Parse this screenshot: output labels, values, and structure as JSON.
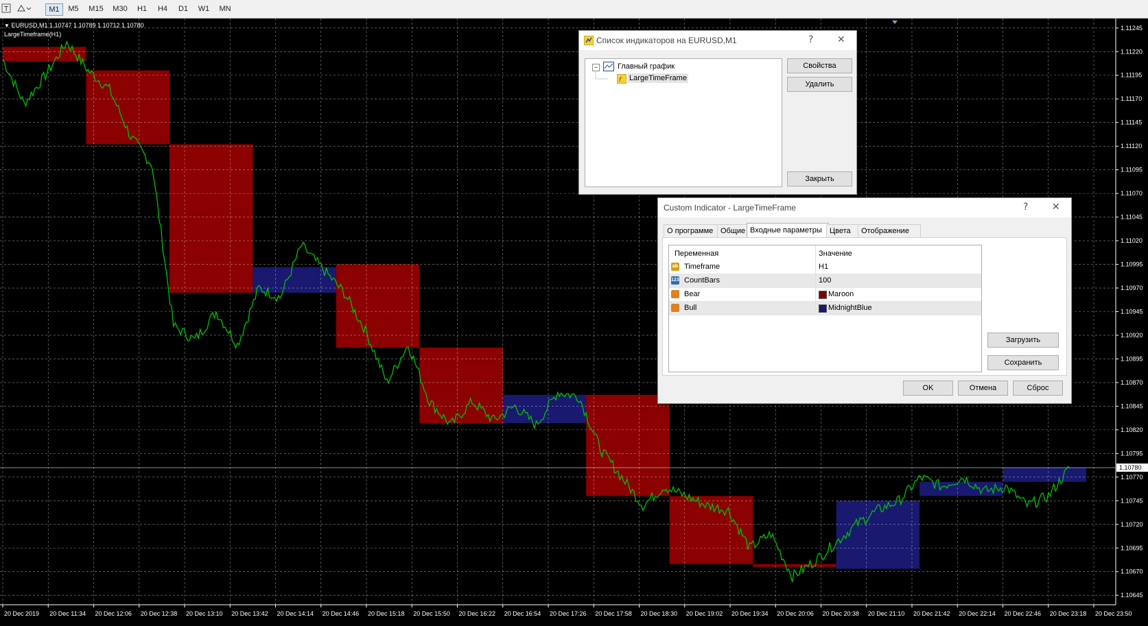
{
  "toolbar": {
    "icons": [
      "text-tool-icon",
      "shapes-tool-icon"
    ],
    "timeframes": [
      "M1",
      "M5",
      "M15",
      "M30",
      "H1",
      "H4",
      "D1",
      "W1",
      "MN"
    ],
    "active_timeframe": "M1"
  },
  "chart": {
    "header_line1": "EURUSD,M1  1.10747 1.10789 1.10712 1.10780",
    "header_line2": "LargeTimeframe(H1)",
    "current_price": "1.10780",
    "price_labels": [
      "1.11245",
      "1.11220",
      "1.11195",
      "1.11170",
      "1.11145",
      "1.11120",
      "1.11095",
      "1.11070",
      "1.11045",
      "1.11020",
      "1.10995",
      "1.10970",
      "1.10945",
      "1.10920",
      "1.10895",
      "1.10870",
      "1.10845",
      "1.10820",
      "1.10795",
      "1.10770",
      "1.10745",
      "1.10720",
      "1.10695",
      "1.10670",
      "1.10645"
    ],
    "time_labels": [
      "20 Dec 2019",
      "20 Dec 11:34",
      "20 Dec 12:06",
      "20 Dec 12:38",
      "20 Dec 13:10",
      "20 Dec 13:42",
      "20 Dec 14:14",
      "20 Dec 14:46",
      "20 Dec 15:18",
      "20 Dec 15:50",
      "20 Dec 16:22",
      "20 Dec 16:54",
      "20 Dec 17:26",
      "20 Dec 17:58",
      "20 Dec 18:30",
      "20 Dec 19:02",
      "20 Dec 19:34",
      "20 Dec 20:06",
      "20 Dec 20:38",
      "20 Dec 21:10",
      "20 Dec 21:42",
      "20 Dec 22:14",
      "20 Dec 22:46",
      "20 Dec 23:18",
      "20 Dec 23:50"
    ],
    "colors": {
      "bear": "#8b0000",
      "bull": "#191970",
      "line": "#00c000",
      "grid": "#ffffff",
      "background": "#000000"
    },
    "boxes": [
      {
        "dir": "bear",
        "open": 1.11225,
        "close": 1.1121,
        "start": 0,
        "end": 1
      },
      {
        "dir": "bear",
        "open": 1.112,
        "close": 1.11122,
        "start": 1,
        "end": 2
      },
      {
        "dir": "bear",
        "open": 1.11122,
        "close": 1.10965,
        "start": 2,
        "end": 3
      },
      {
        "dir": "bull",
        "open": 1.10965,
        "close": 1.10992,
        "start": 3,
        "end": 4
      },
      {
        "dir": "bear",
        "open": 1.10995,
        "close": 1.10907,
        "start": 4,
        "end": 5
      },
      {
        "dir": "bear",
        "open": 1.10907,
        "close": 1.10827,
        "start": 5,
        "end": 6
      },
      {
        "dir": "bull",
        "open": 1.10827,
        "close": 1.10857,
        "start": 6,
        "end": 7
      },
      {
        "dir": "bear",
        "open": 1.10857,
        "close": 1.1075,
        "start": 7,
        "end": 8
      },
      {
        "dir": "bear",
        "open": 1.1075,
        "close": 1.10678,
        "start": 8,
        "end": 9
      },
      {
        "dir": "bear",
        "open": 1.10678,
        "close": 1.10675,
        "start": 9,
        "end": 10
      },
      {
        "dir": "bull",
        "open": 1.10673,
        "close": 1.10745,
        "start": 10,
        "end": 11
      },
      {
        "dir": "bull",
        "open": 1.1075,
        "close": 1.10765,
        "start": 11,
        "end": 12
      },
      {
        "dir": "bull",
        "open": 1.10765,
        "close": 1.1078,
        "start": 12,
        "end": 13
      }
    ],
    "price_path": [
      1.11212,
      1.11165,
      1.11195,
      1.1123,
      1.112,
      1.1118,
      1.1113,
      1.111,
      1.1093,
      1.10915,
      1.10945,
      1.1091,
      1.1097,
      1.1096,
      1.11015,
      1.1099,
      1.10965,
      1.10925,
      1.1087,
      1.1091,
      1.1085,
      1.10825,
      1.1085,
      1.1083,
      1.10845,
      1.10825,
      1.1086,
      1.10855,
      1.108,
      1.1077,
      1.1074,
      1.1076,
      1.1075,
      1.1074,
      1.10735,
      1.10695,
      1.1071,
      1.10665,
      1.1068,
      1.107,
      1.1072,
      1.10735,
      1.10745,
      1.1077,
      1.1076,
      1.1077,
      1.10755,
      1.1076,
      1.1074,
      1.1075,
      1.1078
    ]
  },
  "indicators_dialog": {
    "title": "Список индикаторов на EURUSD,M1",
    "help": "?",
    "close": "✕",
    "tree": {
      "root": "Главный график",
      "child": "LargeTimeFrame"
    },
    "buttons": {
      "properties": "Свойства",
      "delete": "Удалить",
      "close": "Закрыть"
    }
  },
  "custom_dialog": {
    "title": "Custom Indicator - LargeTimeFrame",
    "help": "?",
    "close": "✕",
    "tabs": [
      "О программе",
      "Общие",
      "Входные параметры",
      "Цвета",
      "Отображение"
    ],
    "active_tab": "Входные параметры",
    "columns": [
      "Переменная",
      "Значение"
    ],
    "params": [
      {
        "icon": "ab",
        "name": "Timeframe",
        "value": "H1",
        "color": ""
      },
      {
        "icon": "123",
        "name": "CountBars",
        "value": "100",
        "color": ""
      },
      {
        "icon": "clr",
        "name": "Bear",
        "value": "Maroon",
        "color": "#800000"
      },
      {
        "icon": "clr",
        "name": "Bull",
        "value": "MidnightBlue",
        "color": "#191970"
      }
    ],
    "buttons": {
      "load": "Загрузить",
      "save": "Сохранить",
      "ok": "OK",
      "cancel": "Отмена",
      "reset": "Сброс"
    }
  }
}
